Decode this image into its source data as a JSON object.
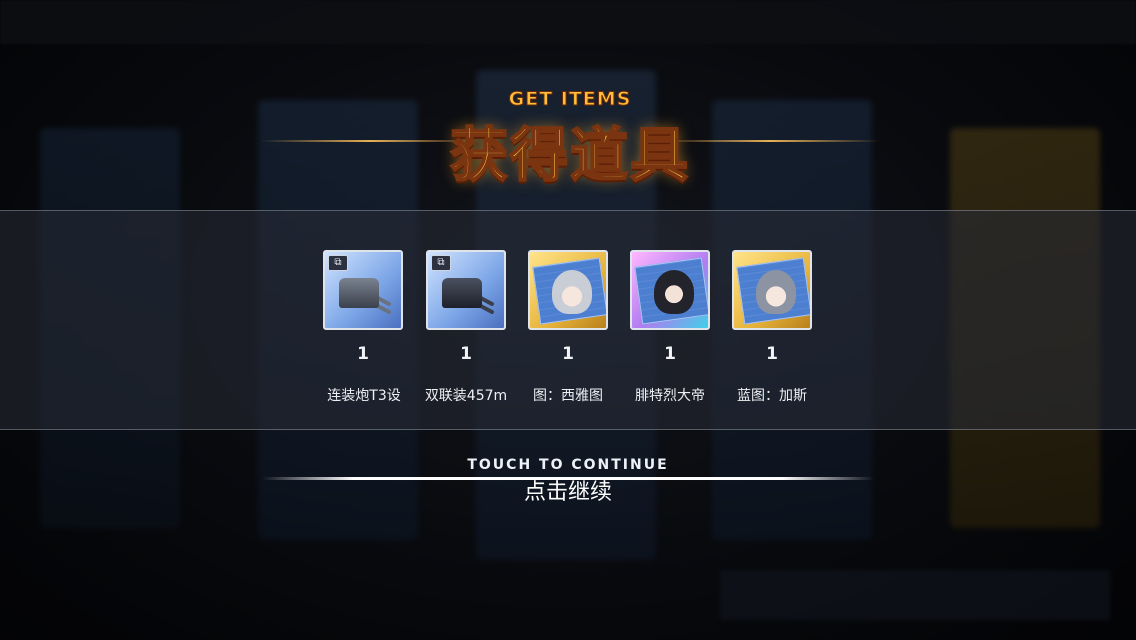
{
  "title": {
    "english": "GET ITEMS",
    "chinese": "获得道具"
  },
  "items": [
    {
      "quantity": "1",
      "name": "连装炮T3设",
      "frame": "blue",
      "icon": "naval-turret-icon",
      "has_badge": true
    },
    {
      "quantity": "1",
      "name": "双联装457m",
      "frame": "blue",
      "icon": "naval-turret-dark-icon",
      "has_badge": true
    },
    {
      "quantity": "1",
      "name": "图：西雅图",
      "frame": "gold",
      "icon": "blueprint-icon",
      "has_badge": false
    },
    {
      "quantity": "1",
      "name": "腓特烈大帝",
      "frame": "purple",
      "icon": "blueprint-icon",
      "has_badge": false
    },
    {
      "quantity": "1",
      "name": "蓝图：加斯",
      "frame": "gold",
      "icon": "blueprint-icon",
      "has_badge": false
    }
  ],
  "continue": {
    "english": "TOUCH TO CONTINUE",
    "chinese": "点击继续"
  },
  "badge_glyph": "⧉"
}
